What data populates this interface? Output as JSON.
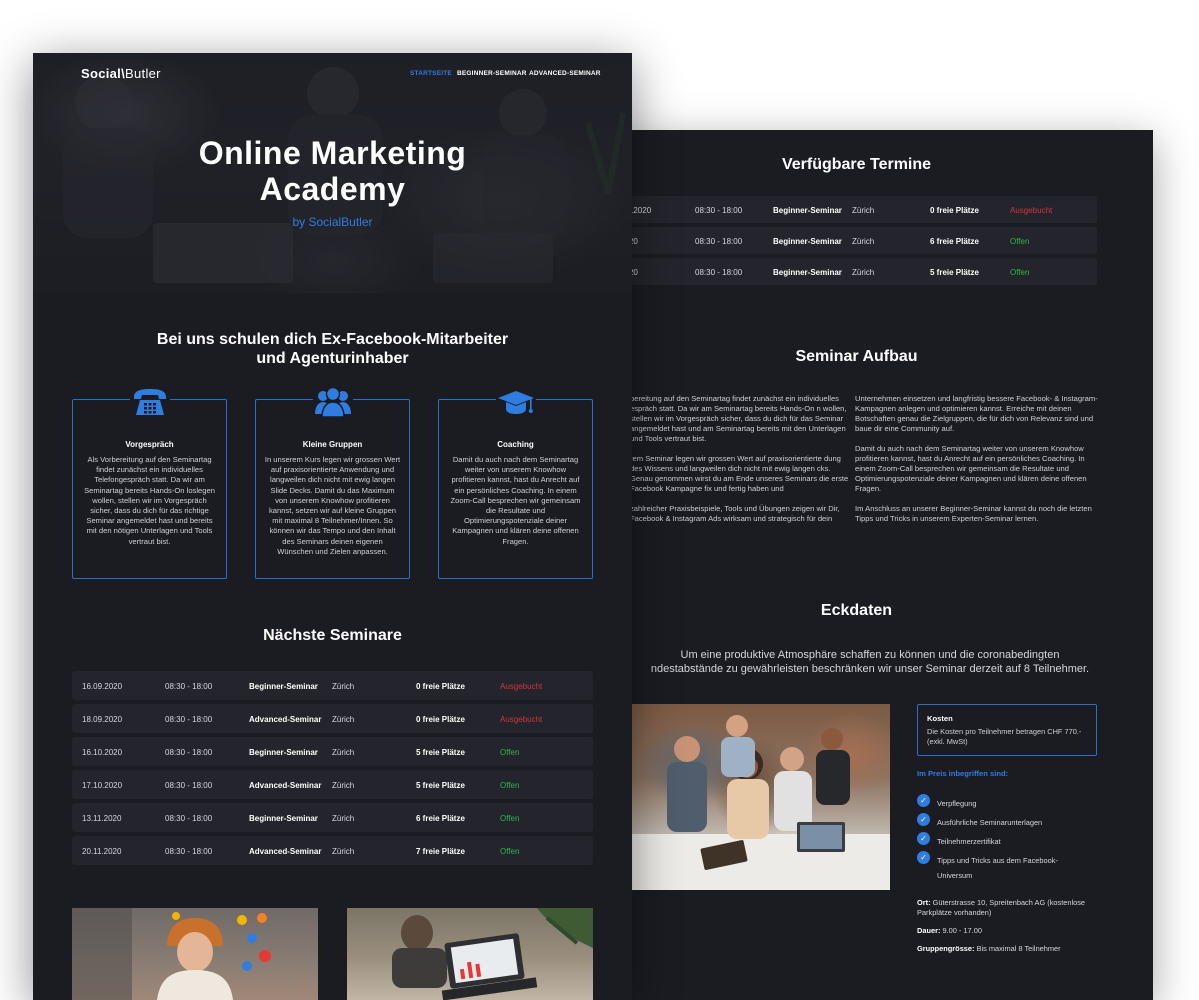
{
  "brand": {
    "name_bold": "Social",
    "slash": "\\",
    "name_light": "Butler"
  },
  "nav": [
    {
      "label": "STARTSEITE",
      "active": true
    },
    {
      "label": "BEGINNER-SEMINAR",
      "active": false
    },
    {
      "label": "ADVANCED-SEMINAR",
      "active": false
    }
  ],
  "hero": {
    "title_line1": "Online Marketing",
    "title_line2": "Academy",
    "subtitle": "by SocialButler"
  },
  "intro": {
    "heading_line1": "Bei uns schulen dich Ex-Facebook-Mitarbeiter",
    "heading_line2": "und Agenturinhaber"
  },
  "features": [
    {
      "icon": "telephone-icon",
      "title": "Vorgespräch",
      "text": "Als Vorbereitung auf den Seminartag findet zunächst ein individuelles Telefongespräch statt. Da wir am Seminartag bereits Hands-On loslegen wollen, stellen wir im Vorgespräch sicher, dass du dich für das richtige Seminar angemeldet hast und bereits mit den nötigen Unterlagen und Tools vertraut bist."
    },
    {
      "icon": "group-icon",
      "title": "Kleine Gruppen",
      "text": "In unserem Kurs legen wir grossen Wert auf praxisorientierte Anwendung und langweilen dich nicht mit ewig langen Slide Decks. Damit du das Maximum von unserem Knowhow profitieren kannst, setzen wir auf kleine Gruppen mit maximal 8 Teilnehmer/Innen. So können wir das Tempo und den Inhalt des Seminars deinen eigenen Wünschen und Zielen anpassen."
    },
    {
      "icon": "graduation-cap-icon",
      "title": "Coaching",
      "text": "Damit du auch nach dem Seminartag weiter von unserem Knowhow profitieren kannst, hast du Anrecht auf ein persönliches Coaching. In einem Zoom-Call besprechen wir gemeinsam die Resultate und Optimierungspotenziale deiner Kampagnen und klären deine offenen Fragen."
    }
  ],
  "next_seminars": {
    "heading": "Nächste Seminare",
    "rows": [
      {
        "date": "16.09.2020",
        "time": "08:30 - 18:00",
        "type": "Beginner-Seminar",
        "city": "Zürich",
        "seats": "0 freie Plätze",
        "status": "Ausgebucht",
        "status_color": "#d2333d"
      },
      {
        "date": "18.09.2020",
        "time": "08:30 - 18:00",
        "type": "Advanced-Seminar",
        "city": "Zürich",
        "seats": "0 freie Plätze",
        "status": "Ausgebucht",
        "status_color": "#d2333d"
      },
      {
        "date": "16.10.2020",
        "time": "08:30 - 18:00",
        "type": "Beginner-Seminar",
        "city": "Zürich",
        "seats": "5 freie Plätze",
        "status": "Offen",
        "status_color": "#2fb44e"
      },
      {
        "date": "17.10.2020",
        "time": "08:30 - 18:00",
        "type": "Advanced-Seminar",
        "city": "Zürich",
        "seats": "5 freie Plätze",
        "status": "Offen",
        "status_color": "#2fb44e"
      },
      {
        "date": "13.11.2020",
        "time": "08:30 - 18:00",
        "type": "Beginner-Seminar",
        "city": "Zürich",
        "seats": "6 freie Plätze",
        "status": "Offen",
        "status_color": "#2fb44e"
      },
      {
        "date": "20.11.2020",
        "time": "08:30 - 18:00",
        "type": "Advanced-Seminar",
        "city": "Zürich",
        "seats": "7 freie Plätze",
        "status": "Offen",
        "status_color": "#2fb44e"
      }
    ]
  },
  "available_dates": {
    "heading": "Verfügbare Termine",
    "rows": [
      {
        "date": ".09.2020",
        "time": "08:30 - 18:00",
        "type": "Beginner-Seminar",
        "city": "Zürich",
        "seats": "0 freie Plätze",
        "status": "Ausgebucht",
        "status_color": "#d2333d"
      },
      {
        "date": "2020",
        "time": "08:30 - 18:00",
        "type": "Beginner-Seminar",
        "city": "Zürich",
        "seats": "6 freie Plätze",
        "status": "Offen",
        "status_color": "#2fb44e"
      },
      {
        "date": "2020",
        "time": "08:30 - 18:00",
        "type": "Beginner-Seminar",
        "city": "Zürich",
        "seats": "5 freie Plätze",
        "status": "Offen",
        "status_color": "#2fb44e"
      }
    ]
  },
  "structure": {
    "heading": "Seminar Aufbau",
    "left_col": [
      "bereitung auf den Seminartag findet zunächst ein individuelles espräch statt. Da wir am Seminartag bereits Hands-On n wollen, stellen wir im Vorgespräch sicher, dass du dich für das Seminar angemeldet hast und am Seminartag bereits mit den Unterlagen und Tools vertraut bist.",
      "rem Seminar legen wir grossen Wert auf praxisorientierte dung des Wissens und langweilen dich nicht mit ewig langen cks. Genau genommen wirst du am Ende unseres Seminars die erste Facebook Kampagne fix und fertig haben und",
      "zahlreicher Praxisbeispiele, Tools und Übungen zeigen wir Dir, Facebook & Instagram Ads wirksam und strategisch für dein"
    ],
    "right_col": [
      "Unternehmen einsetzen und langfristig bessere Facebook- & Instagram-Kampagnen anlegen und optimieren kannst. Erreiche mit deinen Botschaften genau die Zielgruppen, die für dich von Relevanz sind und baue dir eine Community auf.",
      "Damit du auch nach dem Seminartag weiter von unserem Knowhow profitieren kannst, hast du Anrecht auf ein persönliches Coaching. In einem Zoom-Call besprechen wir gemeinsam die Resultate und Optimierungspotenziale deiner Kampagnen und klären deine offenen Fragen.",
      "Im Anschluss an unserer Beginner-Seminar kannst du noch die letzten Tipps und Tricks in unserem Experten-Seminar lernen."
    ]
  },
  "key_data": {
    "heading": "Eckdaten",
    "intro_line1": "Um eine produktive Atmosphäre schaffen zu können und die coronabedingten",
    "intro_line2": "ndestabstände zu gewährleisten beschränken wir unser Seminar derzeit auf 8 Teilnehmer.",
    "cost_title": "Kosten",
    "cost_text": "Die Kosten pro Teilnehmer betragen CHF 770.- (exkl. MwSt)",
    "included_title": "Im Preis inbegriffen sind:",
    "included": [
      "Verpflegung",
      "Ausführliche Seminarunterlagen",
      "Teilnehmerzertifikat",
      "Tipps und Tricks aus dem Facebook-Universum"
    ],
    "location_label": "Ort:",
    "location_value": "Güterstrasse 10, Spreitenbach AG (kostenlose Parkplätze vorhanden)",
    "duration_label": "Dauer:",
    "duration_value": "9.00 - 17.00",
    "group_label": "Gruppengrösse:",
    "group_value": "Bis maximal 8 Teilnehmer"
  },
  "colors": {
    "accent": "#2f7de1",
    "page_bg": "#1b1c22",
    "row_bg": "#24252c",
    "booked": "#d2333d",
    "open": "#2fb44e"
  }
}
